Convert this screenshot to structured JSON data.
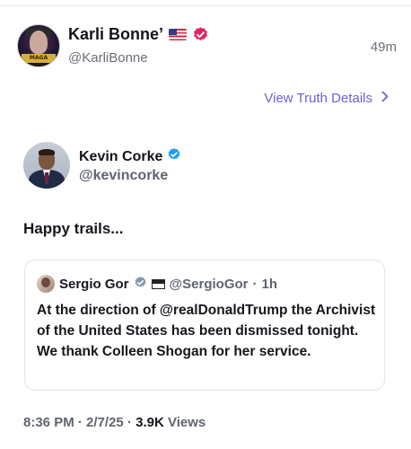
{
  "post": {
    "author_name": "Karli Bonne’",
    "author_handle": "@KarliBonne",
    "time_ago": "49m",
    "avatar_label": "MAGA Tribe",
    "details_link": "View Truth Details"
  },
  "quoted": {
    "author_name": "Kevin Corke",
    "author_handle": "@kevincorke",
    "text": "Happy trails...",
    "inner_quote": {
      "author_name": "Sergio Gor",
      "author_handle": "@SergioGor",
      "separator": "·",
      "time": "1h",
      "text": "At the direction of @realDonaldTrump the Archivist of the United States has been dismissed tonight. We thank Colleen Shogan for her service."
    },
    "meta": {
      "time": "8:36 PM",
      "date": "2/7/25",
      "views_count": "3.9K",
      "views_label": "Views"
    }
  },
  "colors": {
    "link": "#6f5fd6",
    "verified_blue": "#1d9bf0",
    "verified_red": "#e0245e",
    "muted": "#5f6470"
  },
  "icons": [
    "us-flag-icon",
    "verified-red-icon",
    "chevron-right-icon",
    "verified-blue-icon",
    "verified-gray-icon",
    "flag-emoji-icon"
  ]
}
